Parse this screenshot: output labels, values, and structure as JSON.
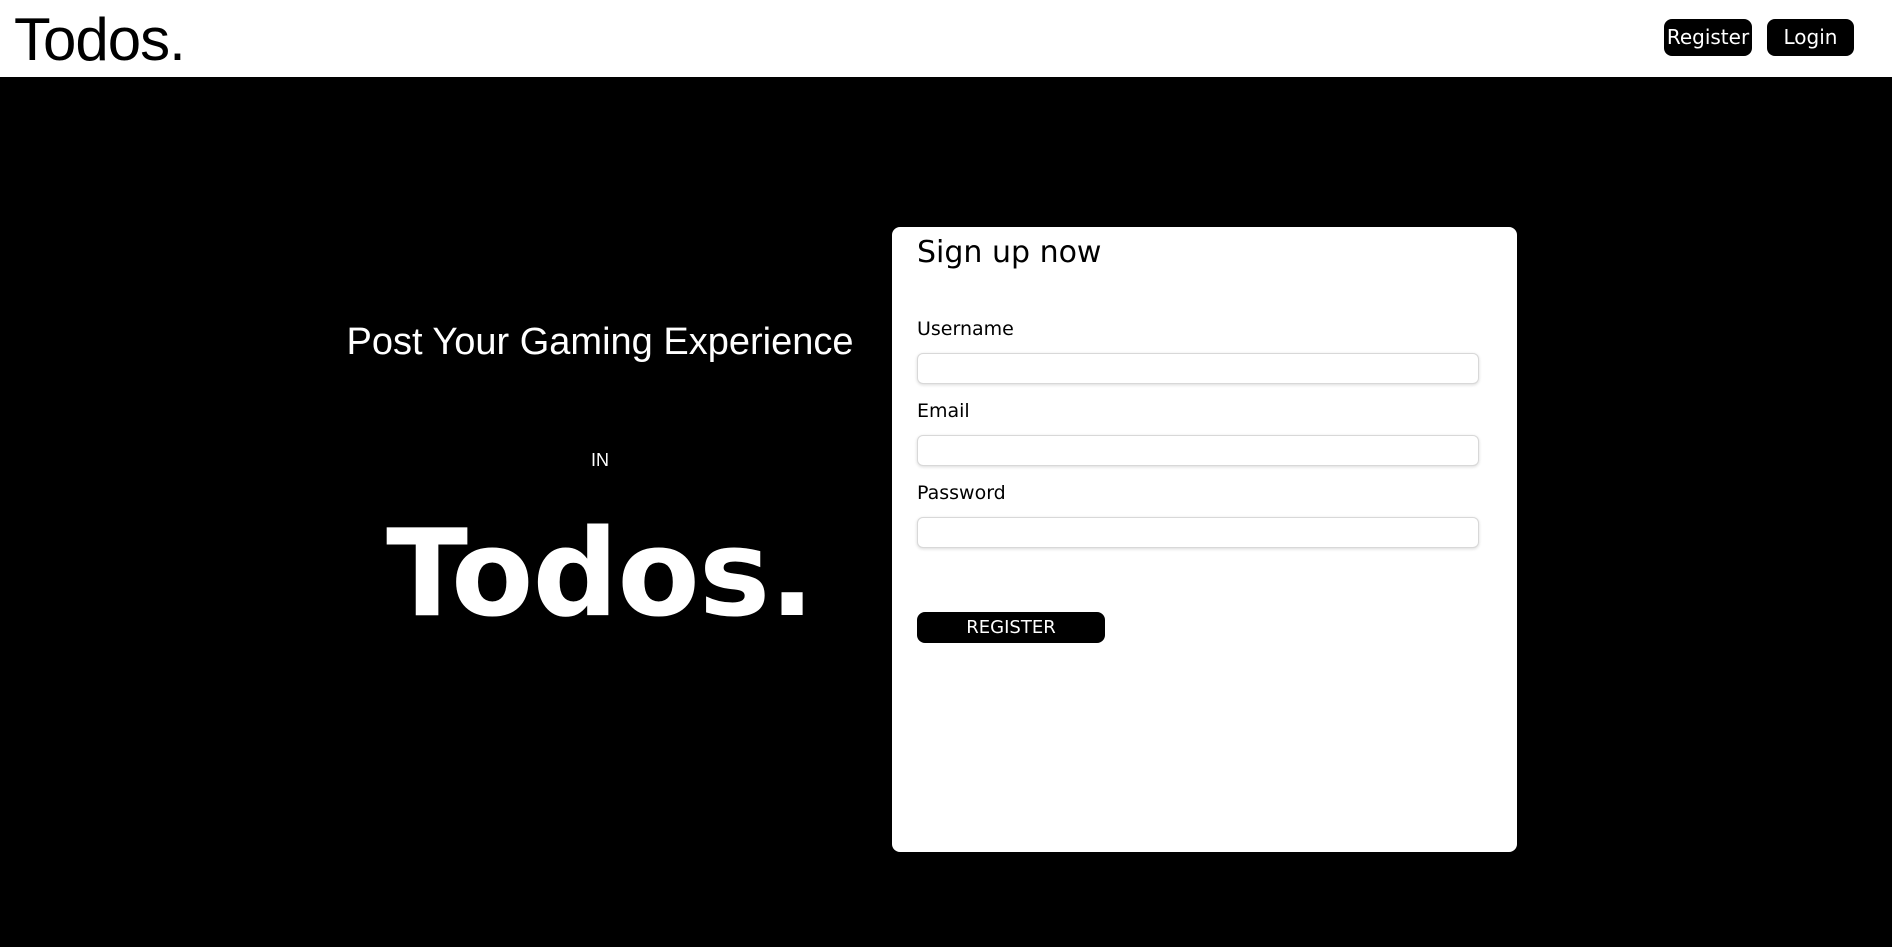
{
  "header": {
    "brand": "Todos.",
    "nav": {
      "register_label": "Register",
      "login_label": "Login"
    }
  },
  "hero": {
    "tagline": "Post Your Gaming Experience",
    "connector": "IN",
    "brand": "Todos."
  },
  "signup_form": {
    "title": "Sign up now",
    "fields": [
      {
        "label": "Username",
        "value": "",
        "placeholder": ""
      },
      {
        "label": "Email",
        "value": "",
        "placeholder": ""
      },
      {
        "label": "Password",
        "value": "",
        "placeholder": ""
      }
    ],
    "submit_label": "REGISTER"
  },
  "colors": {
    "background": "#000000",
    "header_background": "#ffffff",
    "card_background": "#ffffff",
    "button_background": "#000000",
    "button_text": "#ffffff"
  }
}
